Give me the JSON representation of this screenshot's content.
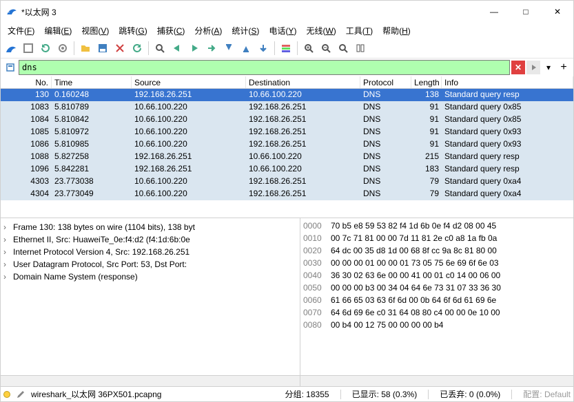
{
  "window": {
    "title": "*以太网 3"
  },
  "menus": [
    {
      "label": "文件",
      "key": "F"
    },
    {
      "label": "编辑",
      "key": "E"
    },
    {
      "label": "视图",
      "key": "V"
    },
    {
      "label": "跳转",
      "key": "G"
    },
    {
      "label": "捕获",
      "key": "C"
    },
    {
      "label": "分析",
      "key": "A"
    },
    {
      "label": "统计",
      "key": "S"
    },
    {
      "label": "电话",
      "key": "Y"
    },
    {
      "label": "无线",
      "key": "W"
    },
    {
      "label": "工具",
      "key": "T"
    },
    {
      "label": "帮助",
      "key": "H"
    }
  ],
  "filter": {
    "value": "dns"
  },
  "columns": {
    "no": "No.",
    "time": "Time",
    "src": "Source",
    "dst": "Destination",
    "proto": "Protocol",
    "len": "Length",
    "info": "Info"
  },
  "packets": [
    {
      "no": "130",
      "time": "0.160248",
      "src": "192.168.26.251",
      "dst": "10.66.100.220",
      "proto": "DNS",
      "len": "138",
      "info": "Standard query resp",
      "sel": true
    },
    {
      "no": "1083",
      "time": "5.810789",
      "src": "10.66.100.220",
      "dst": "192.168.26.251",
      "proto": "DNS",
      "len": "91",
      "info": "Standard query 0x85"
    },
    {
      "no": "1084",
      "time": "5.810842",
      "src": "10.66.100.220",
      "dst": "192.168.26.251",
      "proto": "DNS",
      "len": "91",
      "info": "Standard query 0x85"
    },
    {
      "no": "1085",
      "time": "5.810972",
      "src": "10.66.100.220",
      "dst": "192.168.26.251",
      "proto": "DNS",
      "len": "91",
      "info": "Standard query 0x93"
    },
    {
      "no": "1086",
      "time": "5.810985",
      "src": "10.66.100.220",
      "dst": "192.168.26.251",
      "proto": "DNS",
      "len": "91",
      "info": "Standard query 0x93"
    },
    {
      "no": "1088",
      "time": "5.827258",
      "src": "192.168.26.251",
      "dst": "10.66.100.220",
      "proto": "DNS",
      "len": "215",
      "info": "Standard query resp"
    },
    {
      "no": "1096",
      "time": "5.842281",
      "src": "192.168.26.251",
      "dst": "10.66.100.220",
      "proto": "DNS",
      "len": "183",
      "info": "Standard query resp"
    },
    {
      "no": "4303",
      "time": "23.773038",
      "src": "10.66.100.220",
      "dst": "192.168.26.251",
      "proto": "DNS",
      "len": "79",
      "info": "Standard query 0xa4"
    },
    {
      "no": "4304",
      "time": "23.773049",
      "src": "10.66.100.220",
      "dst": "192.168.26.251",
      "proto": "DNS",
      "len": "79",
      "info": "Standard query 0xa4"
    }
  ],
  "tree": [
    {
      "exp": true,
      "text": "Frame 130: 138 bytes on wire (1104 bits), 138 byt"
    },
    {
      "exp": true,
      "text": "Ethernet II, Src: HuaweiTe_0e:f4:d2 (f4:1d:6b:0e"
    },
    {
      "exp": true,
      "text": "Internet Protocol Version 4, Src: 192.168.26.251"
    },
    {
      "exp": true,
      "text": "User Datagram Protocol, Src Port: 53, Dst Port: "
    },
    {
      "exp": true,
      "text": "Domain Name System (response)"
    }
  ],
  "hex": [
    {
      "off": "0000",
      "b": "70 b5 e8 59 53 82 f4 1d   6b 0e f4 d2 08 00 45"
    },
    {
      "off": "0010",
      "b": "00 7c 71 81 00 00 7d 11   81 2e c0 a8 1a fb 0a"
    },
    {
      "off": "0020",
      "b": "64 dc 00 35 d8 1d 00 68   8f cc 9a 8c 81 80 00"
    },
    {
      "off": "0030",
      "b": "00 00 00 01 00 00 01 73   05 75 6e 69 6f 6e 03"
    },
    {
      "off": "0040",
      "b": "36 30 02 63 6e 00 00 41   00 01 c0 14 00 06 00"
    },
    {
      "off": "0050",
      "b": "00 00 00 b3 00 34 04 64   6e 73 31 07 33 36 30"
    },
    {
      "off": "0060",
      "b": "61 66 65 03 63 6f 6d 00   0b 64 6f 6d 61 69 6e"
    },
    {
      "off": "0070",
      "b": "64 6d 69 6e c0 31 64 08   80 c4 00 00 0e 10 00"
    },
    {
      "off": "0080",
      "b": "00 b4 00 12 75 00 00 00   00 b4"
    }
  ],
  "status": {
    "file": "wireshark_以太网 36PX501.pcapng",
    "pkts": "分组: 18355",
    "disp": "已显示: 58 (0.3%)",
    "drop": "已丢弃: 0 (0.0%)",
    "profile": "配置: Default"
  },
  "icons": {
    "min": "—",
    "max": "□",
    "close": "✕",
    "clear": "✕",
    "plus": "+",
    "dd": "▾",
    "arrow": "›"
  }
}
